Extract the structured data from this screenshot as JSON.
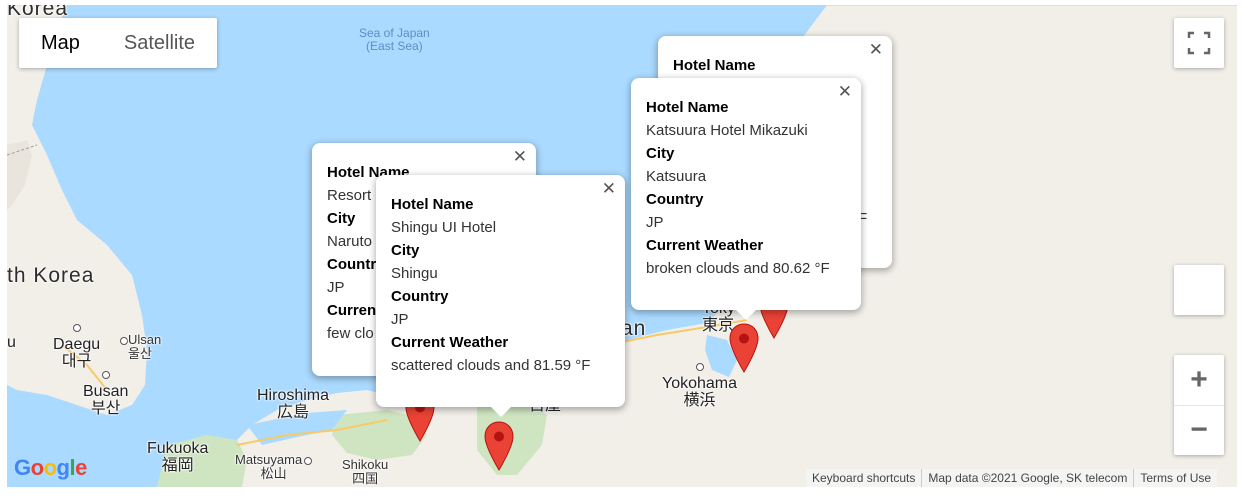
{
  "map_type": {
    "map": "Map",
    "satellite": "Satellite",
    "selected": "Map"
  },
  "labels": {
    "korea_top": "Korea",
    "sea_line1": "Sea of Japan",
    "sea_line2": "(East Sea)",
    "south_korea": "th Korea",
    "daegu": "Daegu",
    "daegu_ko": "대구",
    "ulsan": "Ulsan",
    "ulsan_ko": "울산",
    "busan": "Busan",
    "busan_ko": "부산",
    "u_left": "u",
    "hiroshima": "Hiroshima",
    "hiroshima_ja": "広島",
    "fukuoka": "Fukuoka",
    "fukuoka_ja": "福岡",
    "matsuyama": "Matsuyama",
    "matsuyama_ja": "松山",
    "shikoku": "Shikoku",
    "shikoku_ja": "四国",
    "tokyo_ja": "東京",
    "tokyo_partial": "Toky",
    "yokohama": "Yokohama",
    "yokohama_ja": "横浜",
    "japan_partial": "an",
    "nagoya_ja": "古屋"
  },
  "info_windows": [
    {
      "hotel_name_label": "Hotel Name",
      "hotel_name": "",
      "city_label": "City",
      "city": "",
      "country_label": "Country",
      "country": "",
      "weather_label": "Current Weather",
      "weather": "F"
    },
    {
      "hotel_name_label": "Hotel Name",
      "hotel_name": "Resort",
      "city_label": "City",
      "city": "Naruto",
      "country_label": "Countr",
      "country": "JP",
      "weather_label": "Curren",
      "weather": "few clo"
    },
    {
      "hotel_name_label": "Hotel Name",
      "hotel_name": "Shingu UI Hotel",
      "city_label": "City",
      "city": "Shingu",
      "country_label": "Country",
      "country": "JP",
      "weather_label": "Current Weather",
      "weather": "scattered clouds and 81.59 °F"
    },
    {
      "hotel_name_label": "Hotel Name",
      "hotel_name": "Katsuura Hotel Mikazuki",
      "city_label": "City",
      "city": "Katsuura",
      "country_label": "Country",
      "country": "JP",
      "weather_label": "Current Weather",
      "weather": "broken clouds and 80.62 °F"
    }
  ],
  "controls": {
    "zoom_in": "+",
    "zoom_out": "−",
    "fullscreen_icon": "fullscreen-icon"
  },
  "logo": {
    "text": "Google",
    "colors": [
      "#4285F4",
      "#EA4335",
      "#FBBC05",
      "#4285F4",
      "#34A853",
      "#EA4335"
    ]
  },
  "footer": {
    "keyboard": "Keyboard shortcuts",
    "map_data": "Map data ©2021 Google, SK telecom",
    "terms": "Terms of Use"
  },
  "colors": {
    "water": "#aadaff",
    "land": "#f2efe9",
    "green_land": "#cfe5c2",
    "marker": "#ea4335"
  }
}
